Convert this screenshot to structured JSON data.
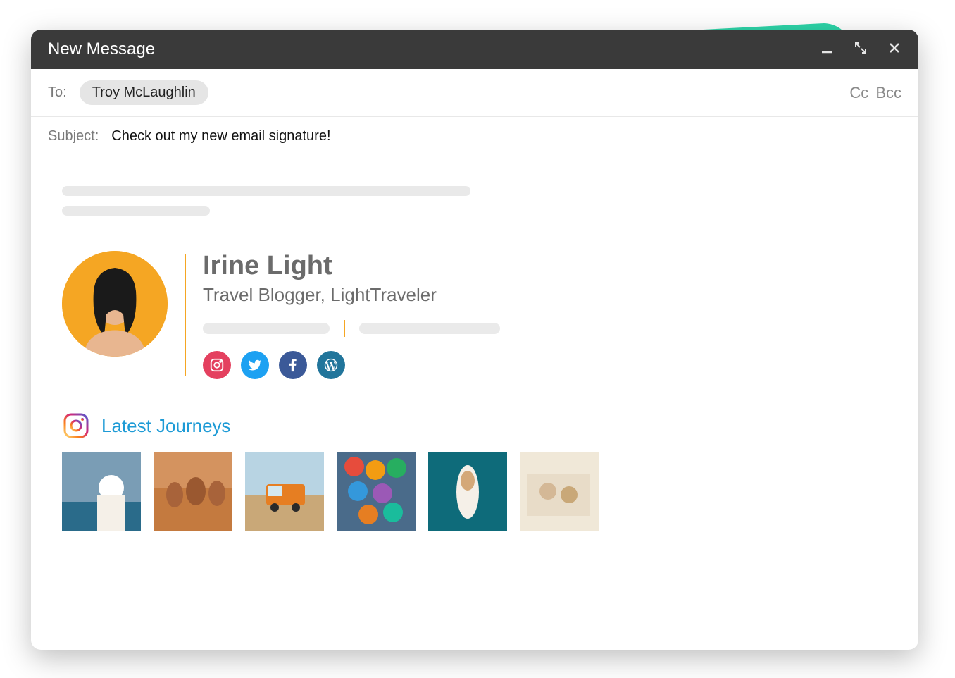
{
  "compose": {
    "title": "New Message",
    "to_label": "To:",
    "recipient": "Troy McLaughlin",
    "cc": "Cc",
    "bcc": "Bcc",
    "subject_label": "Subject:",
    "subject": "Check out my new email signature!"
  },
  "signature": {
    "name": "Irine Light",
    "title": "Travel Blogger, LightTraveler",
    "social_icons": [
      "instagram",
      "twitter",
      "facebook",
      "wordpress"
    ]
  },
  "gallery": {
    "title": "Latest Journeys",
    "thumbs": [
      "beach-hat",
      "camels-desert",
      "orange-van",
      "umbrellas",
      "boat-aerial",
      "van-sunset"
    ]
  }
}
